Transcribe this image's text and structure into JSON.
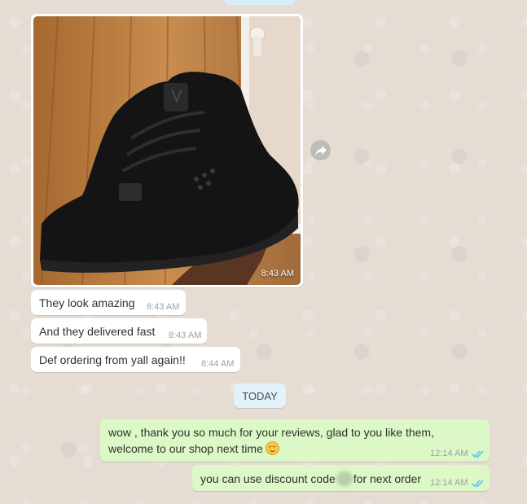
{
  "chat": {
    "image_message": {
      "time": "8:43 AM"
    },
    "incoming": [
      {
        "text": "They look amazing",
        "time": "8:43 AM"
      },
      {
        "text": "And they delivered fast",
        "time": "8:43 AM"
      },
      {
        "text": "Def ordering from yall again!!",
        "time": "8:44 AM"
      }
    ],
    "date_divider": "TODAY",
    "outgoing": [
      {
        "line1": "wow , thank you so much for your reviews, glad to you like them,",
        "line2": "welcome to our shop next time",
        "time": "12:14 AM",
        "status": "read"
      },
      {
        "text_before": "you can use discount code",
        "text_after": "for next order",
        "time": "12:14 AM",
        "status": "read"
      }
    ]
  },
  "colors": {
    "wallpaper": "#e5ddd4",
    "incoming_bubble": "#ffffff",
    "outgoing_bubble": "#dcf8c6",
    "read_ticks": "#4fc3f7",
    "date_pill": "#e1f2fb"
  },
  "icons": [
    "forward-icon",
    "double-check-icon",
    "smiling-face-emoji"
  ]
}
